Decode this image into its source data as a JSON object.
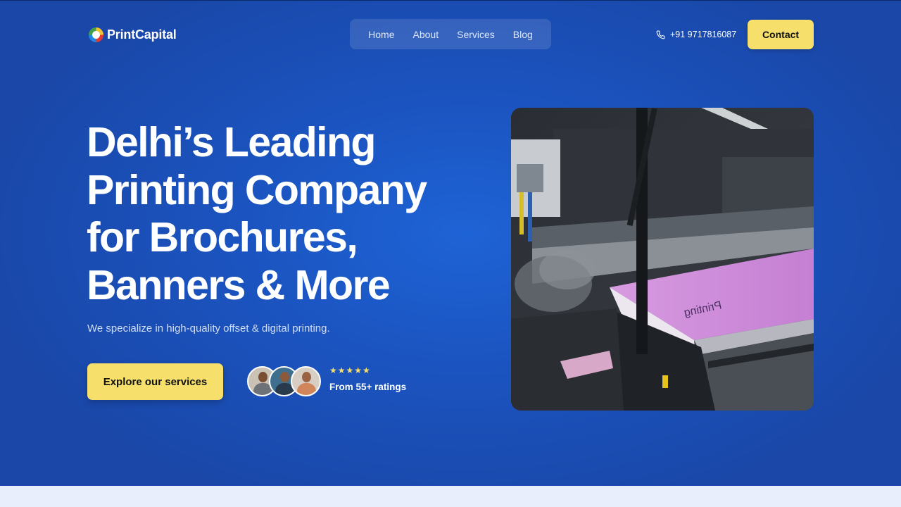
{
  "brand": {
    "name": "PrintCapital"
  },
  "nav": {
    "items": [
      {
        "label": "Home"
      },
      {
        "label": "About"
      },
      {
        "label": "Services"
      },
      {
        "label": "Blog"
      }
    ]
  },
  "header": {
    "phone": "+91 9717816087",
    "contact_label": "Contact"
  },
  "hero": {
    "headline_lines": [
      "Delhi’s Leading",
      "Printing Company",
      "for Brochures,",
      "Banners & More"
    ],
    "subtitle": "We specialize in high-quality offset & digital printing.",
    "cta_label": "Explore our services",
    "stars": "★★★★★",
    "rating_text": "From 55+ ratings"
  },
  "colors": {
    "hero_bg": "#1b54c0",
    "accent_yellow": "#f6df6a",
    "text_light": "#ffffff"
  },
  "icons": {
    "phone": "phone-icon",
    "logo": "printcapital-logo-icon"
  }
}
